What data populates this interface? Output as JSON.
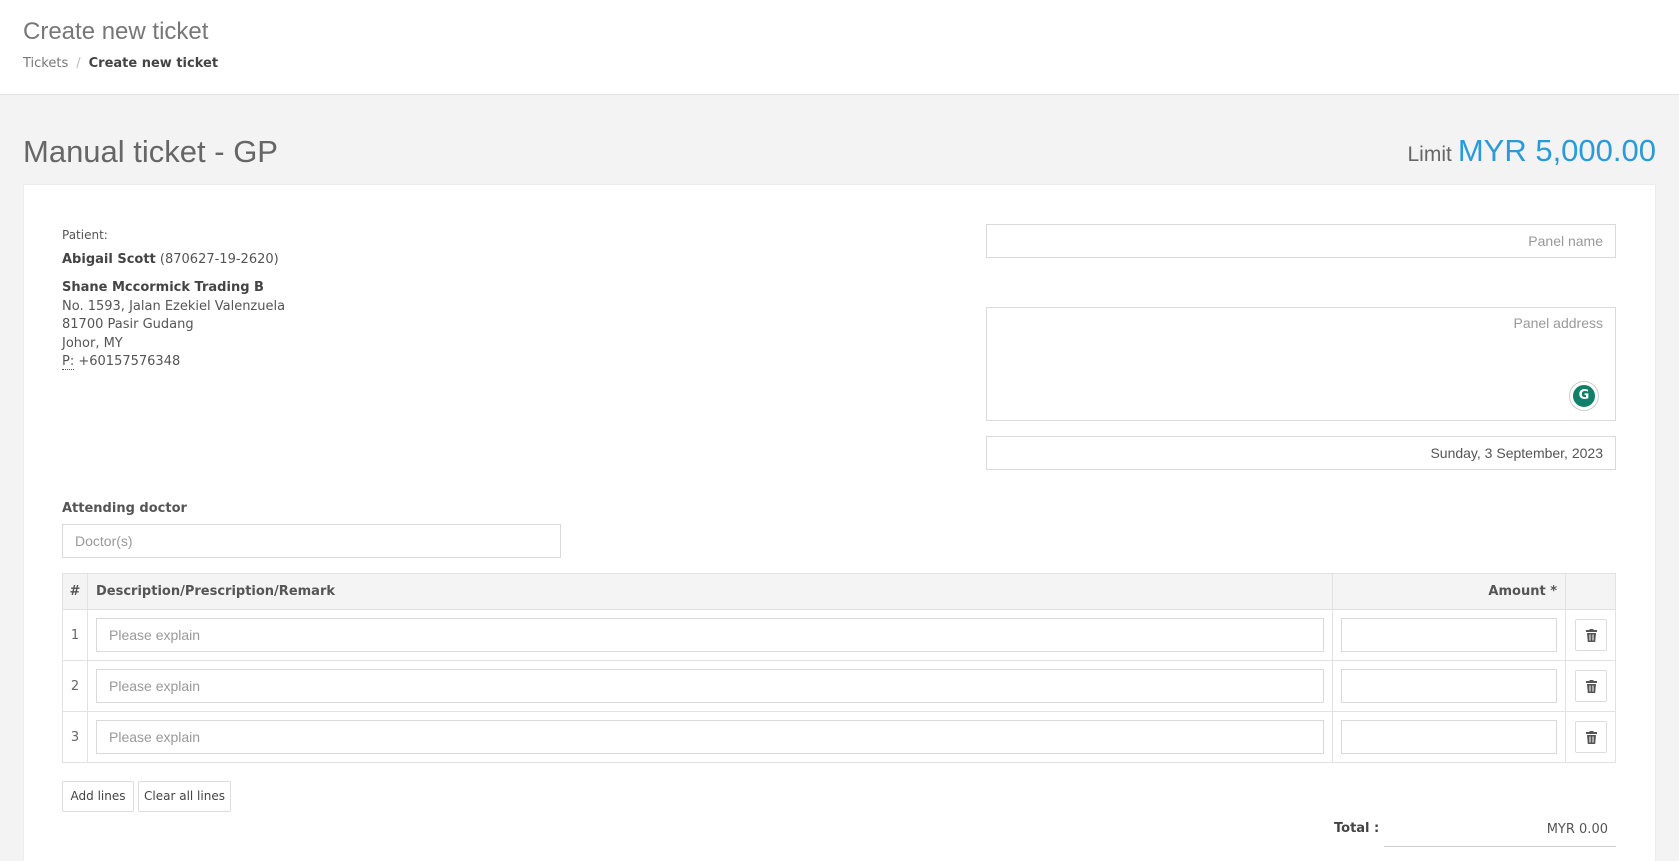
{
  "header": {
    "title": "Create new ticket",
    "breadcrumb": [
      {
        "label": "Tickets"
      },
      {
        "label": "Create new ticket"
      }
    ]
  },
  "section": {
    "title": "Manual ticket - GP",
    "limit_label": "Limit",
    "limit_value": "MYR 5,000.00"
  },
  "patient": {
    "caption": "Patient:",
    "name": "Abigail Scott",
    "ic": "(870627-19-2620)",
    "company": "Shane Mccormick Trading B",
    "address1": "No. 1593, Jalan Ezekiel Valenzuela",
    "address2": "81700 Pasir Gudang",
    "address3": "Johor, MY",
    "phone_label": "P:",
    "phone": "+60157576348"
  },
  "panel": {
    "name_placeholder": "Panel name",
    "address_placeholder": "Panel address",
    "date": "Sunday, 3 September, 2023"
  },
  "doctor": {
    "label": "Attending doctor",
    "placeholder": "Doctor(s)"
  },
  "table": {
    "headers": {
      "num": "#",
      "desc": "Description/Prescription/Remark",
      "amount": "Amount *"
    },
    "rows": [
      {
        "num": "1",
        "desc_placeholder": "Please explain",
        "amount": ""
      },
      {
        "num": "2",
        "desc_placeholder": "Please explain",
        "amount": ""
      },
      {
        "num": "3",
        "desc_placeholder": "Please explain",
        "amount": ""
      }
    ]
  },
  "actions": {
    "add_lines": "Add lines",
    "clear_all": "Clear all lines"
  },
  "total": {
    "label": "Total :",
    "value": "MYR 0.00"
  },
  "colors": {
    "accent": "#2a9bd8",
    "grammarly": "#10806a"
  }
}
